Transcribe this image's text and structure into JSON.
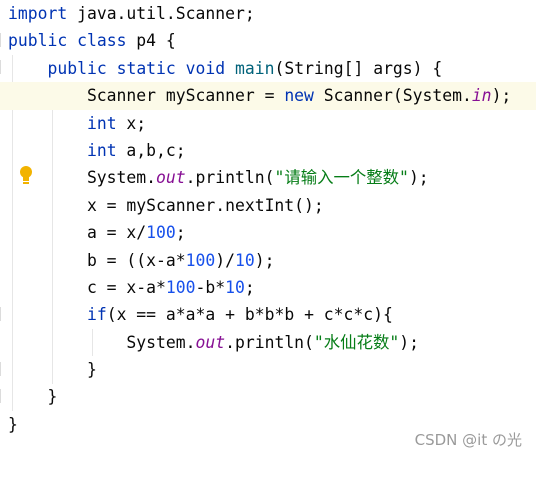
{
  "editor": {
    "lines": [
      [
        "import java.util.Scanner;"
      ],
      [
        "public class p4 {"
      ],
      [
        "    public static void main(String[] args) {"
      ],
      [
        "        Scanner myScanner = new Scanner(System.in);"
      ],
      [
        "        int x;"
      ],
      [
        "        int a,b,c;"
      ],
      [
        "        System.out.println(\"请输入一个整数\");"
      ],
      [
        "        x = myScanner.nextInt();"
      ],
      [
        "        a = x/100;"
      ],
      [
        "        b = ((x-a*100)/10);"
      ],
      [
        "        c = x-a*100-b*10;"
      ],
      [
        "        if(x == a*a*a + b*b*b + c*c*c){"
      ],
      [
        "            System.out.println(\"水仙花数\");"
      ],
      [
        "        }"
      ],
      [
        "    }"
      ],
      [
        "}"
      ]
    ],
    "tokens": {
      "l0": [
        "import",
        " java.util.Scanner;"
      ],
      "l1": [
        "public",
        " ",
        "class",
        " p4 {"
      ],
      "l2": [
        "    ",
        "public",
        " ",
        "static",
        " ",
        "void",
        " ",
        "main",
        "(String[] args) {"
      ],
      "l3": [
        "        Scanner myScanner = ",
        "new",
        " Scanner(System.",
        "in",
        ");"
      ],
      "l4": [
        "        ",
        "int",
        " x;"
      ],
      "l5": [
        "        ",
        "int",
        " a,b,c;"
      ],
      "l6": [
        "        System.",
        "out",
        ".println(",
        "\"请输入一个整数\"",
        ");"
      ],
      "l7": [
        "        x = myScanner.nextInt();"
      ],
      "l8": [
        "        a = x/",
        "100",
        ";"
      ],
      "l9": [
        "        b = ((x-a*",
        "100",
        ")/",
        "10",
        ");"
      ],
      "l10": [
        "        c = x-a*",
        "100",
        "-b*",
        "10",
        ";"
      ],
      "l11": [
        "        ",
        "if",
        "(x == a*a*a + b*b*b + c*c*c){"
      ],
      "l12": [
        "            System.",
        "out",
        ".println(",
        "\"水仙花数\"",
        ");"
      ],
      "l13": [
        "        }"
      ],
      "l14": [
        "    }"
      ],
      "l15": [
        "}"
      ]
    }
  },
  "gutter": {
    "intention_icon": "lightbulb-icon",
    "intention_color": "#f2b300"
  },
  "watermark": {
    "text": "CSDN @it の光"
  },
  "colors": {
    "keyword": "#0033b3",
    "number": "#1750eb",
    "string": "#067d17",
    "field": "#871094",
    "method": "#00627a",
    "current_line": "#fcfae8"
  }
}
